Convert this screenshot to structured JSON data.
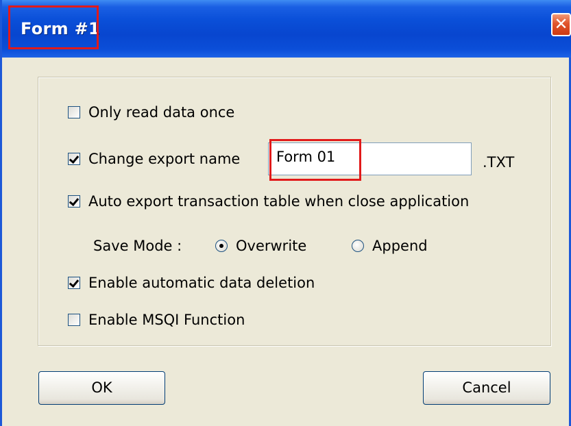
{
  "window": {
    "title": "Form #1",
    "close_glyph": "✕"
  },
  "options": {
    "only_read_once": {
      "label": "Only read data once",
      "checked": false
    },
    "change_export_name": {
      "label": "Change export name",
      "checked": true,
      "value": "Form 01",
      "extension": ".TXT"
    },
    "auto_export": {
      "label": "Auto export transaction table when close application",
      "checked": true
    },
    "save_mode": {
      "label": "Save Mode :",
      "options": [
        "Overwrite",
        "Append"
      ],
      "selected": "Overwrite"
    },
    "auto_delete": {
      "label": "Enable automatic data deletion",
      "checked": true
    },
    "msqi": {
      "label": "Enable MSQI Function",
      "checked": false
    }
  },
  "buttons": {
    "ok": "OK",
    "cancel": "Cancel"
  },
  "colors": {
    "titlebar": "#0a4fd8",
    "highlight": "#e11a1a",
    "face": "#ece9d8"
  }
}
